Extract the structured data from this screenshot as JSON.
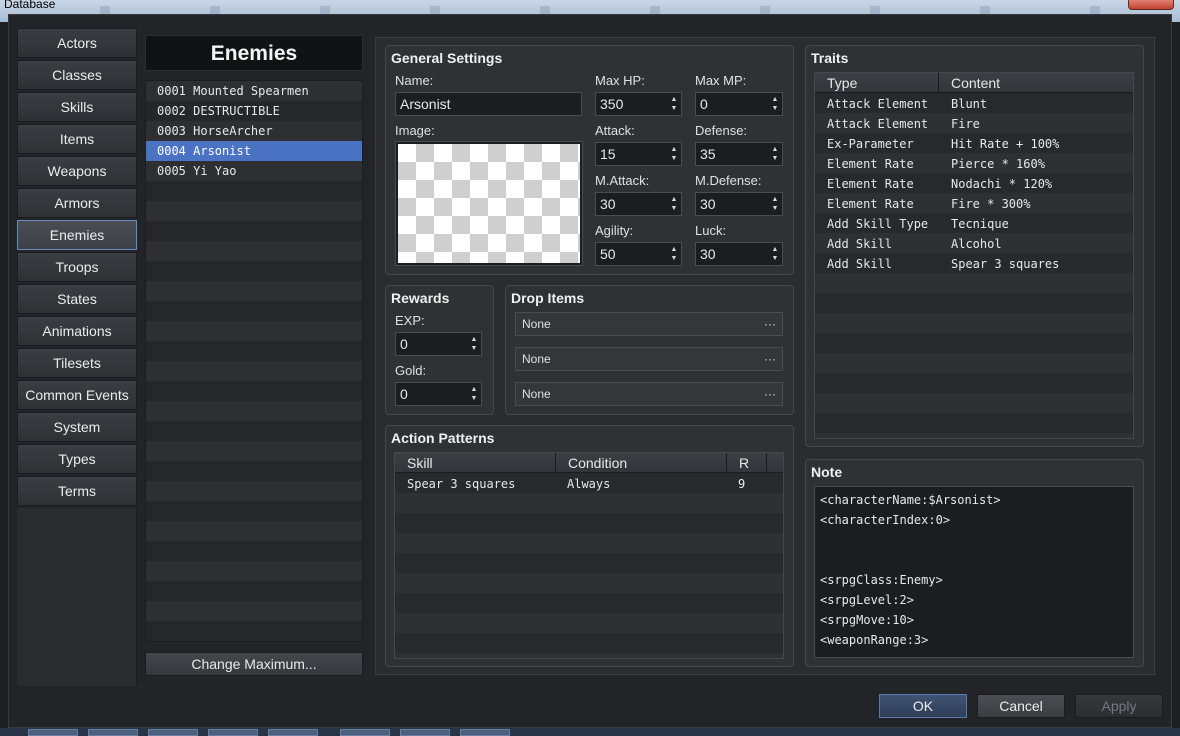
{
  "window": {
    "title": "Database"
  },
  "categories": [
    "Actors",
    "Classes",
    "Skills",
    "Items",
    "Weapons",
    "Armors",
    "Enemies",
    "Troops",
    "States",
    "Animations",
    "Tilesets",
    "Common Events",
    "System",
    "Types",
    "Terms"
  ],
  "enemies": {
    "header": "Enemies",
    "rows": [
      "0001 Mounted Spearmen",
      "0002 DESTRUCTIBLE",
      "0003 HorseArcher",
      "0004 Arsonist",
      "0005 Yi Yao"
    ],
    "change_max": "Change Maximum..."
  },
  "general": {
    "title": "General Settings",
    "name_label": "Name:",
    "name_value": "Arsonist",
    "image_label": "Image:",
    "maxhp_label": "Max HP:",
    "maxhp": "350",
    "maxmp_label": "Max MP:",
    "maxmp": "0",
    "attack_label": "Attack:",
    "attack": "15",
    "defense_label": "Defense:",
    "defense": "35",
    "matk_label": "M.Attack:",
    "matk": "30",
    "mdef_label": "M.Defense:",
    "mdef": "30",
    "agi_label": "Agility:",
    "agi": "50",
    "luck_label": "Luck:",
    "luck": "30"
  },
  "rewards": {
    "title": "Rewards",
    "exp_label": "EXP:",
    "exp": "0",
    "gold_label": "Gold:",
    "gold": "0"
  },
  "drops": {
    "title": "Drop Items",
    "items": [
      "None",
      "None",
      "None"
    ]
  },
  "actions": {
    "title": "Action Patterns",
    "headers": [
      "Skill",
      "Condition",
      "R"
    ],
    "rows": [
      [
        "Spear 3 squares",
        "Always",
        "9"
      ]
    ]
  },
  "traits": {
    "title": "Traits",
    "headers": [
      "Type",
      "Content"
    ],
    "rows": [
      [
        "Attack Element",
        "Blunt"
      ],
      [
        "Attack Element",
        "Fire"
      ],
      [
        "Ex-Parameter",
        "Hit Rate + 100%"
      ],
      [
        "Element Rate",
        "Pierce * 160%"
      ],
      [
        "Element Rate",
        "Nodachi * 120%"
      ],
      [
        "Element Rate",
        "Fire * 300%"
      ],
      [
        "Add Skill Type",
        "Tecnique"
      ],
      [
        "Add Skill",
        "Alcohol"
      ],
      [
        "Add Skill",
        "Spear 3 squares"
      ]
    ]
  },
  "note": {
    "title": "Note",
    "lines": [
      "<characterName:$Arsonist>",
      "<characterIndex:0>",
      "",
      "",
      "<srpgClass:Enemy>",
      "<srpgLevel:2>",
      "<srpgMove:10>",
      "<weaponRange:3>"
    ]
  },
  "footer": {
    "ok": "OK",
    "cancel": "Cancel",
    "apply": "Apply"
  }
}
